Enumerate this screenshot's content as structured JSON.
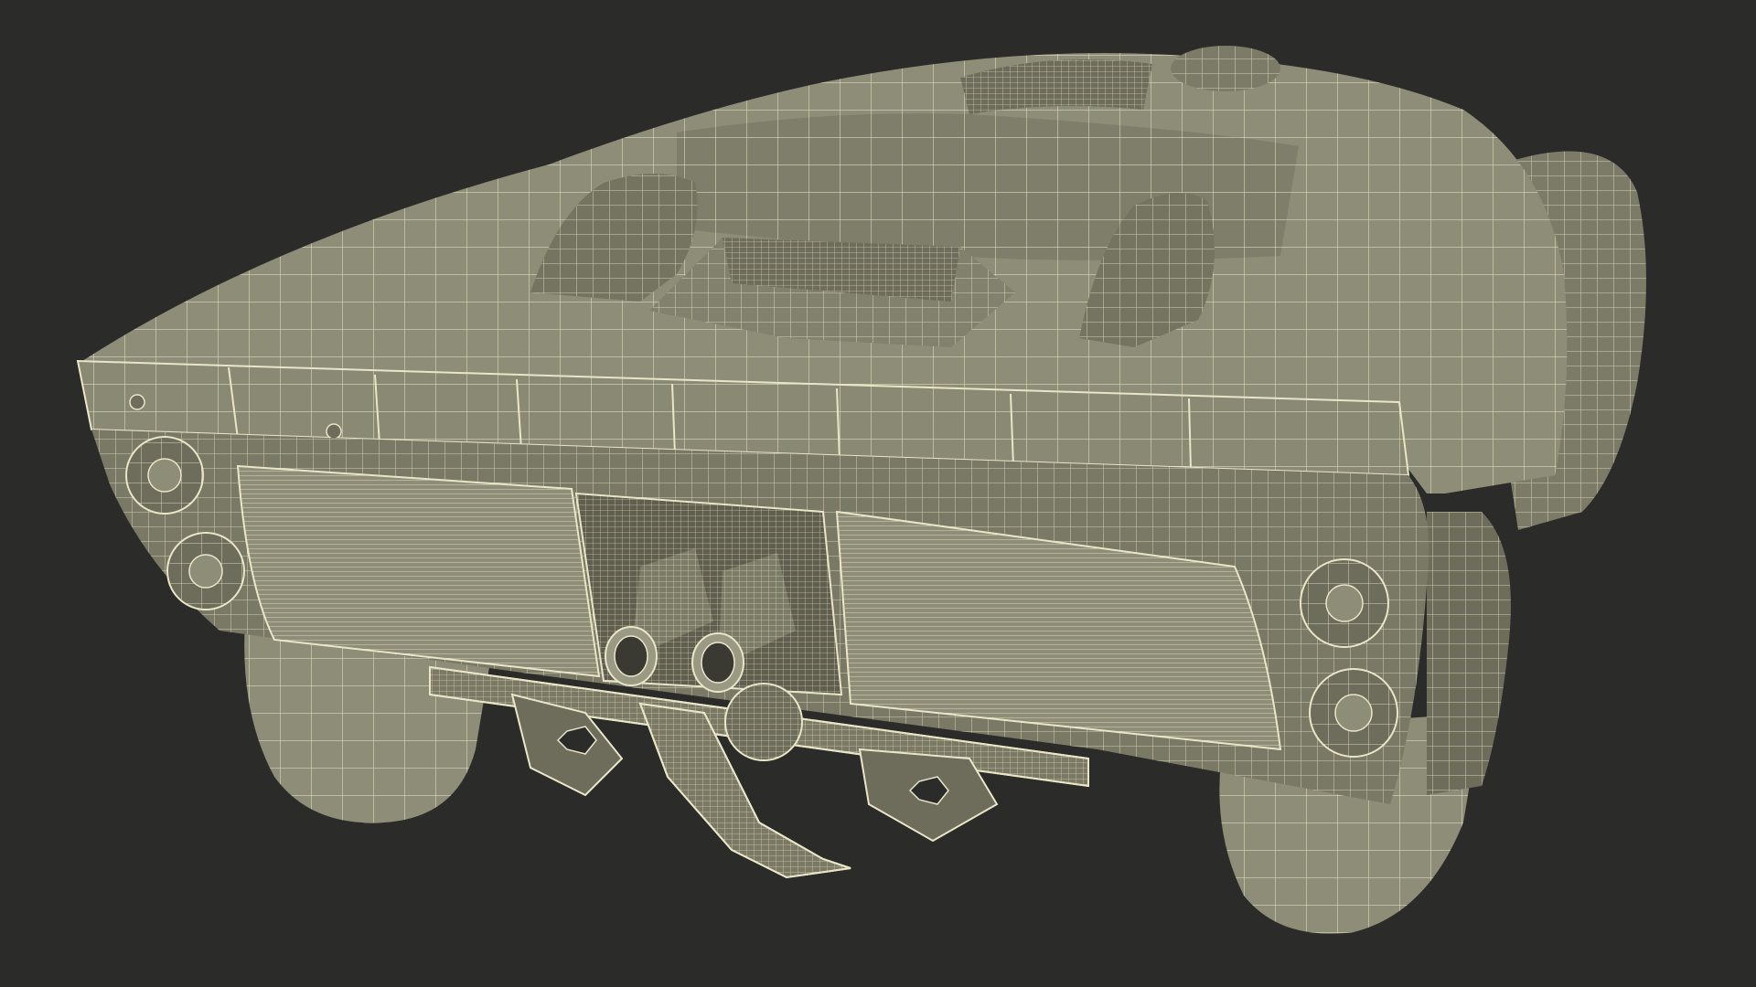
{
  "scene": {
    "background_color": "#2b2b2a",
    "mesh_fill": "#8e8d78",
    "mesh_fill_dark": "#6e6d5c",
    "mesh_fill_light": "#a3a28c",
    "wire_color": "#e9e6c8",
    "subject_icon": "wireframe-race-car-rear-view"
  }
}
